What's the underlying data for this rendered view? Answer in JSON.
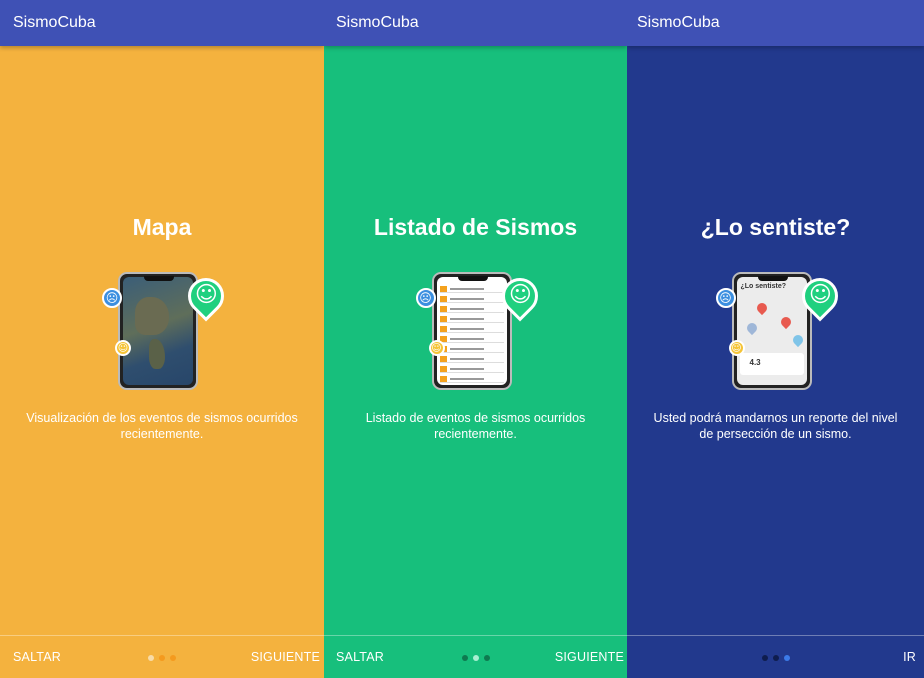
{
  "colors": {
    "appbar": "#3F51B5",
    "screen1_bg": "#F4B23E",
    "screen2_bg": "#17BF7C",
    "screen3_bg": "#22398D"
  },
  "screens": [
    {
      "app_title": "SismoCuba",
      "title": "Mapa",
      "description": "Visualización de los eventos de sismos ocurridos recientemente.",
      "skip_label": "SALTAR",
      "next_label": "SIGUIENTE",
      "active_dot": 0,
      "dot_colors": [
        "#F8DCA8",
        "#F49A1E",
        "#F49A1E"
      ]
    },
    {
      "app_title": "SismoCuba",
      "title": "Listado de Sismos",
      "description": "Listado de eventos de sismos ocurridos recientemente.",
      "skip_label": "SALTAR",
      "next_label": "SIGUIENTE",
      "active_dot": 1,
      "dot_colors": [
        "#0E7A4F",
        "#A8F0D2",
        "#0E7A4F"
      ]
    },
    {
      "app_title": "SismoCuba",
      "title": "¿Lo sentiste?",
      "description": "Usted podrá mandarnos un reporte del nivel de persección de un sismo.",
      "skip_label": "",
      "next_label": "IR",
      "active_dot": 2,
      "dot_colors": [
        "#0F1D4E",
        "#0F1D4E",
        "#3C7BE8"
      ],
      "phone_header": "¿Lo sentiste?",
      "phone_magnitude": "4.3"
    }
  ]
}
